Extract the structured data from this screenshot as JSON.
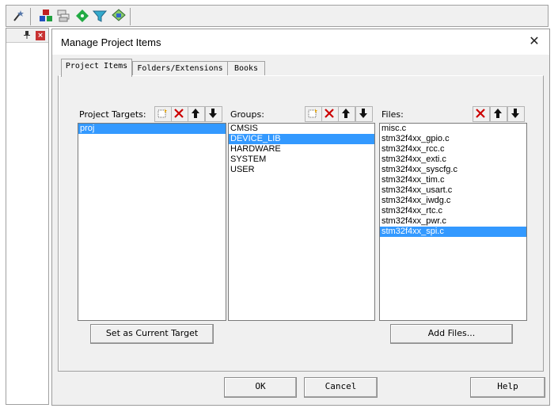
{
  "toolbar": {
    "icons": [
      "magic-wand-icon",
      "project-items-icon",
      "stacked-windows-icon",
      "green-diamond-icon",
      "funnel-icon",
      "layers-icon"
    ]
  },
  "side_pane": {
    "pin": "ᵖ",
    "close": "×"
  },
  "dialog": {
    "title": "Manage Project Items",
    "close": "✕",
    "tabs": [
      {
        "label": "Project Items",
        "active": true
      },
      {
        "label": "Folders/Extensions",
        "active": false
      },
      {
        "label": "Books",
        "active": false
      }
    ],
    "targets": {
      "label": "Project Targets:",
      "items": [
        "proj"
      ],
      "selected": "proj",
      "button": "Set as Current Target"
    },
    "groups": {
      "label": "Groups:",
      "items": [
        "CMSIS",
        "DEVICE_LIB",
        "HARDWARE",
        "SYSTEM",
        "USER"
      ],
      "selected": "DEVICE_LIB"
    },
    "files": {
      "label": "Files:",
      "items": [
        "misc.c",
        "stm32f4xx_gpio.c",
        "stm32f4xx_rcc.c",
        "stm32f4xx_exti.c",
        "stm32f4xx_syscfg.c",
        "stm32f4xx_tim.c",
        "stm32f4xx_usart.c",
        "stm32f4xx_iwdg.c",
        "stm32f4xx_rtc.c",
        "stm32f4xx_pwr.c",
        "stm32f4xx_spi.c"
      ],
      "selected": "stm32f4xx_spi.c",
      "button": "Add Files..."
    },
    "footer": {
      "ok": "OK",
      "cancel": "Cancel",
      "help": "Help"
    },
    "colors": {
      "selection": "#3399ff",
      "delete": "#cc0000"
    }
  }
}
